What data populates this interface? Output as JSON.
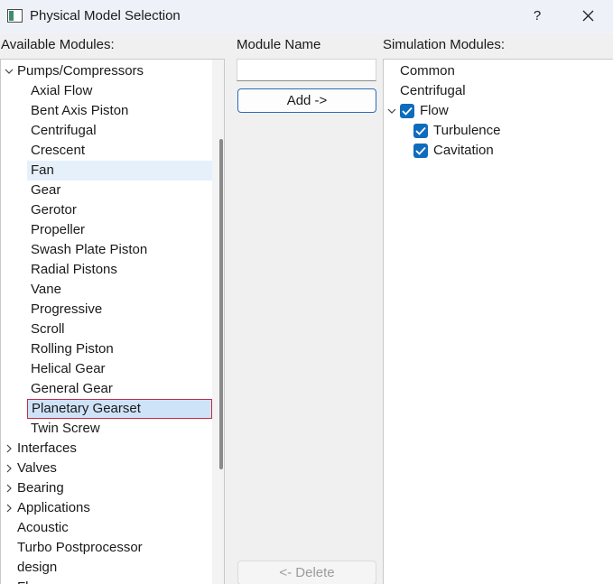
{
  "window": {
    "title": "Physical Model Selection",
    "help_label": "?"
  },
  "available": {
    "heading": "Available Modules:",
    "root": {
      "label": "Pumps/Compressors",
      "expanded": true
    },
    "children": [
      "Axial Flow",
      "Bent Axis Piston",
      "Centrifugal",
      "Crescent",
      "Fan",
      "Gear",
      "Gerotor",
      "Propeller",
      "Swash Plate Piston",
      "Radial Pistons",
      "Vane",
      "Progressive",
      "Scroll",
      "Rolling Piston",
      "Helical Gear",
      "General Gear",
      "Planetary Gearset",
      "Twin Screw"
    ],
    "hovered": "Fan",
    "selected": "Planetary Gearset",
    "collapsed_groups": [
      "Interfaces",
      "Valves",
      "Bearing",
      "Applications"
    ],
    "plain_items": [
      "Acoustic",
      "Turbo Postprocessor",
      "design",
      "Fl..."
    ]
  },
  "module_name": {
    "heading": "Module Name",
    "value": ""
  },
  "buttons": {
    "add": "Add ->",
    "delete": "<- Delete"
  },
  "simulation": {
    "heading": "Simulation Modules:",
    "items": [
      "Common",
      "Centrifugal"
    ],
    "group": {
      "label": "Flow",
      "checked": true,
      "expanded": true
    },
    "sub_items": [
      {
        "label": "Turbulence",
        "checked": true
      },
      {
        "label": "Cavitation",
        "checked": true
      }
    ]
  },
  "colors": {
    "accent": "#0f6cbd",
    "selection_border": "#c42a45",
    "selection_bg": "#cfe3f8"
  }
}
